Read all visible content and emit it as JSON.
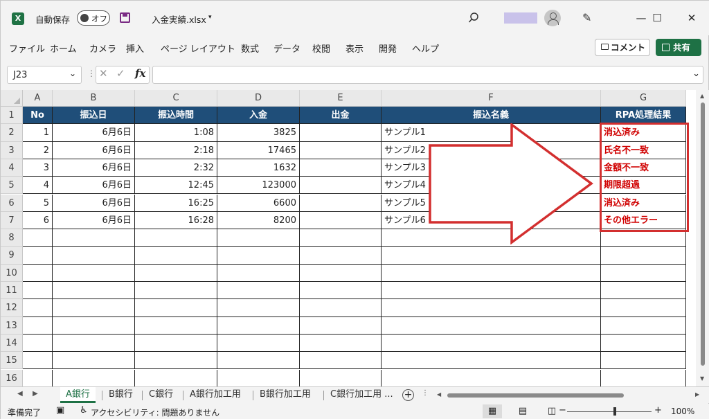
{
  "titlebar": {
    "autosave_label": "自動保存",
    "autosave_toggle": "オフ",
    "filename": "入金実績.xlsx",
    "filename_caret": "▾",
    "minimize": "—",
    "maximize": "☐",
    "close": "✕"
  },
  "menu": {
    "items": [
      "ファイル",
      "ホーム",
      "カメラ",
      "挿入",
      "ページ レイアウト",
      "数式",
      "データ",
      "校閲",
      "表示",
      "開発",
      "ヘルプ"
    ],
    "comment_label": "コメント",
    "share_label": "共有"
  },
  "formula_bar": {
    "name_box": "J23",
    "fx": "fx",
    "value": ""
  },
  "grid": {
    "column_letters": [
      "A",
      "B",
      "C",
      "D",
      "E",
      "F",
      "G"
    ],
    "row_numbers": [
      "1",
      "2",
      "3",
      "4",
      "5",
      "6",
      "7",
      "8",
      "9",
      "10",
      "11",
      "12",
      "13",
      "14",
      "15",
      "16"
    ],
    "headers": [
      "No",
      "振込日",
      "振込時間",
      "入金",
      "出金",
      "振込名義",
      "RPA処理結果"
    ],
    "rows": [
      [
        "1",
        "6月6日",
        "1:08",
        "3825",
        "",
        "サンプル1",
        "消込済み"
      ],
      [
        "2",
        "6月6日",
        "2:18",
        "17465",
        "",
        "サンプル2",
        "氏名不一致"
      ],
      [
        "3",
        "6月6日",
        "2:32",
        "1632",
        "",
        "サンプル3",
        "金額不一致"
      ],
      [
        "4",
        "6月6日",
        "12:45",
        "123000",
        "",
        "サンプル4",
        "期限超過"
      ],
      [
        "5",
        "6月6日",
        "16:25",
        "6600",
        "",
        "サンプル5",
        "消込済み"
      ],
      [
        "6",
        "6月6日",
        "16:28",
        "8200",
        "",
        "サンプル6",
        "その他エラー"
      ]
    ]
  },
  "sheet_tabs": [
    "A銀行",
    "B銀行",
    "C銀行",
    "A銀行加工用",
    "B銀行加工用",
    "C銀行加工用 ..."
  ],
  "statusbar": {
    "ready": "準備完了",
    "accessibility": "アクセシビリティ: 問題ありません",
    "zoom_minus": "−",
    "zoom_plus": "+",
    "zoom": "100%"
  },
  "colors": {
    "header_fill": "#1f4e79",
    "result_text": "#d00000",
    "highlight_border": "#d32f2f",
    "share_button": "#1e7145"
  }
}
